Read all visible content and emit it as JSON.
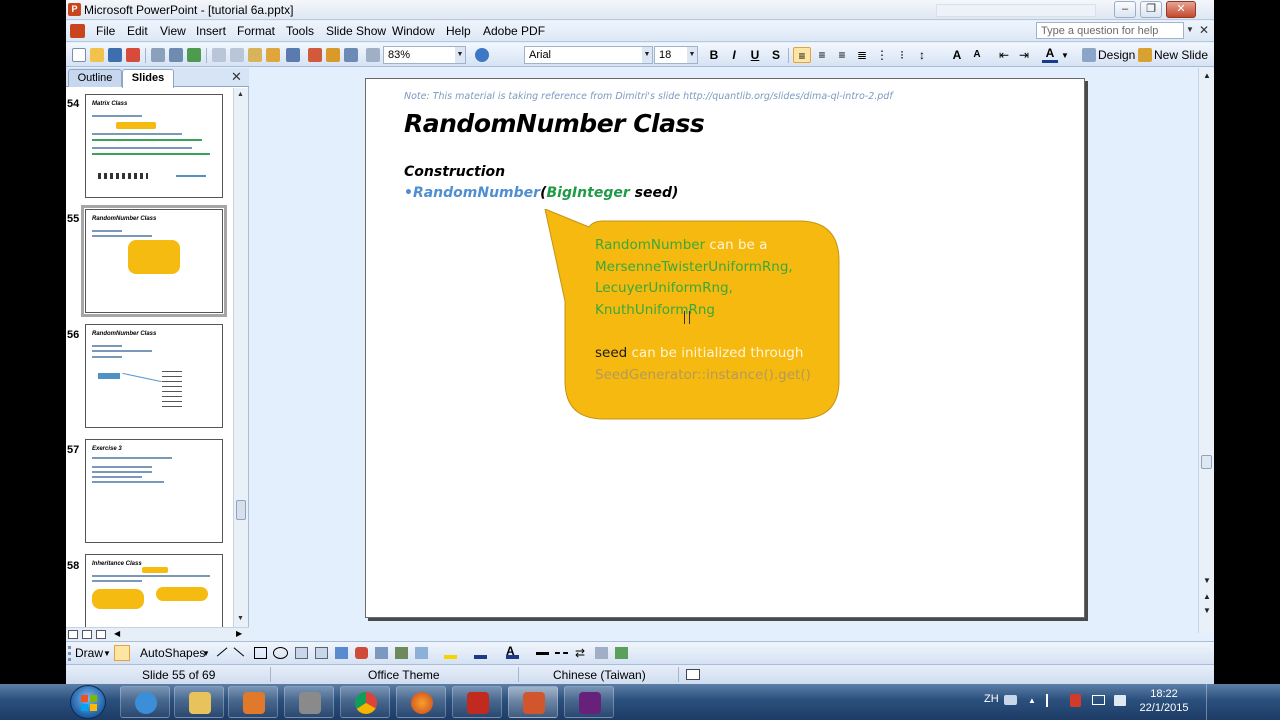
{
  "window": {
    "title": "Microsoft PowerPoint - [tutorial 6a.pptx]",
    "min_label": "–",
    "max_label": "❐",
    "close_label": "✕"
  },
  "menu": {
    "items": [
      "File",
      "Edit",
      "View",
      "Insert",
      "Format",
      "Tools",
      "Slide Show",
      "Window",
      "Help",
      "Adobe PDF"
    ],
    "help_placeholder": "Type a question for help",
    "close_doc": "✕"
  },
  "toolbar": {
    "zoom": "83%",
    "font": "Arial",
    "font_size": "18",
    "bold": "B",
    "italic": "I",
    "underline": "U",
    "shadow": "S",
    "design": "Design",
    "new_slide": "New Slide"
  },
  "panel": {
    "tab_outline": "Outline",
    "tab_slides": "Slides",
    "close": "✕",
    "thumbnails": [
      {
        "number": "54",
        "title": "Matrix Class"
      },
      {
        "number": "55",
        "title": "RandomNumber Class"
      },
      {
        "number": "56",
        "title": "RandomNumber Class"
      },
      {
        "number": "57",
        "title": "Exercise 3"
      },
      {
        "number": "58",
        "title": "Inheritance Class"
      }
    ]
  },
  "slide": {
    "note": "Note: This material is taking reference from Dimitri's slide http://quantlib.org/slides/dima-ql-intro-2.pdf",
    "title": "RandomNumber Class",
    "construction": "Construction",
    "ctor_bullet": "•",
    "ctor_name": "RandomNumber",
    "ctor_open": "(",
    "ctor_type": "BigInteger",
    "ctor_param": " seed)",
    "callout": {
      "l1_green": "RandomNumber",
      "l1_white": " can be a",
      "l2": "MersenneTwisterUniformRng,",
      "l3": "LecuyerUniformRng,",
      "l4": "KnuthUniformRng",
      "l5_black": "seed",
      "l5_white": " can be initialized through",
      "l6": "SeedGenerator::instance().get()"
    }
  },
  "drawbar": {
    "draw": "Draw",
    "autoshapes": "AutoShapes"
  },
  "status": {
    "slide": "Slide 55 of 69",
    "theme": "Office Theme",
    "language": "Chinese (Taiwan)"
  },
  "taskbar": {
    "ime": "ZH",
    "time": "18:22",
    "date": "22/1/2015"
  },
  "colors": {
    "callout_fill": "#f6b90f",
    "slide_green": "#1f9a47",
    "slide_blue": "#4f8fd1"
  }
}
